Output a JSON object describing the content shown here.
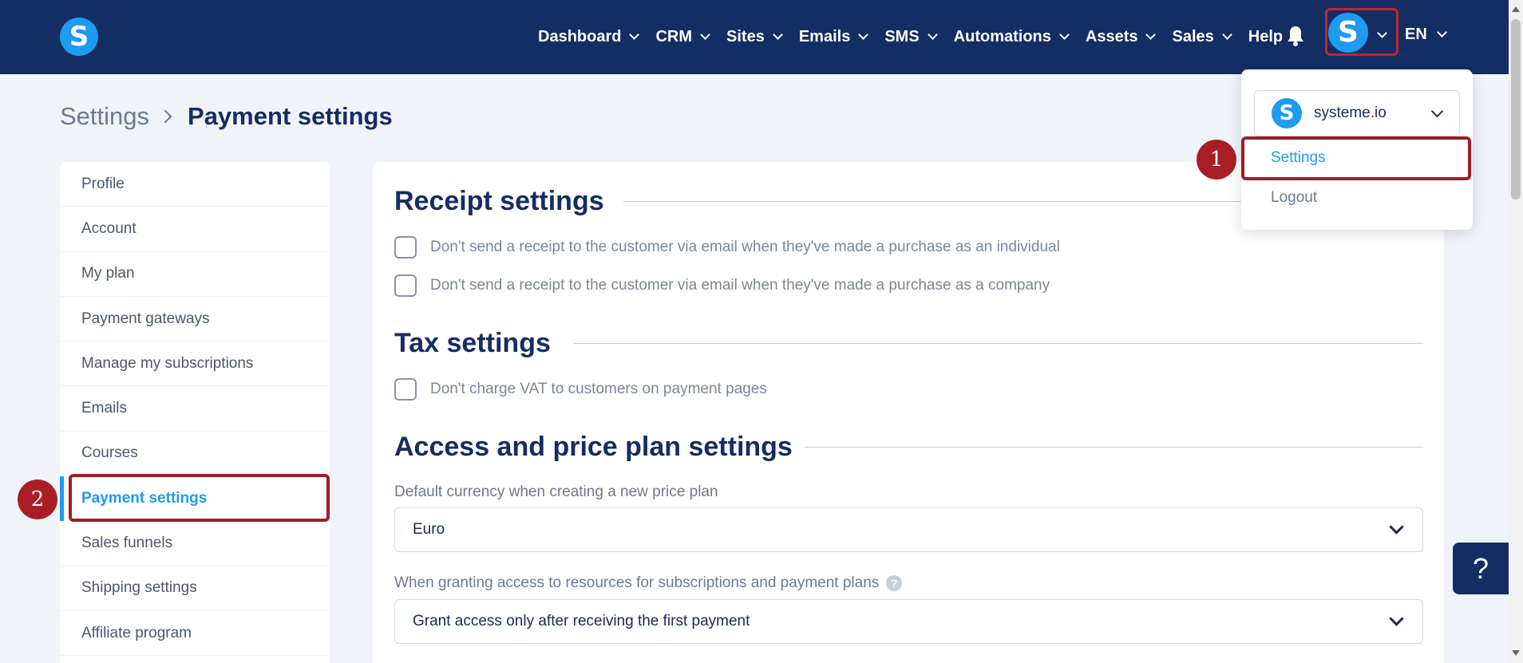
{
  "app": {
    "logo_letter": "S"
  },
  "nav": {
    "items": [
      {
        "label": "Dashboard",
        "has_dropdown": true
      },
      {
        "label": "CRM",
        "has_dropdown": true
      },
      {
        "label": "Sites",
        "has_dropdown": true
      },
      {
        "label": "Emails",
        "has_dropdown": true
      },
      {
        "label": "SMS",
        "has_dropdown": true
      },
      {
        "label": "Automations",
        "has_dropdown": true
      },
      {
        "label": "Assets",
        "has_dropdown": true
      },
      {
        "label": "Sales",
        "has_dropdown": true
      },
      {
        "label": "Help",
        "has_dropdown": false
      }
    ],
    "bell_icon": "bell-icon",
    "avatar_letter": "S",
    "language": "EN"
  },
  "breadcrumb": {
    "parent": "Settings",
    "current": "Payment settings"
  },
  "sidebar": {
    "items": [
      {
        "label": "Profile",
        "active": false
      },
      {
        "label": "Account",
        "active": false
      },
      {
        "label": "My plan",
        "active": false
      },
      {
        "label": "Payment gateways",
        "active": false
      },
      {
        "label": "Manage my subscriptions",
        "active": false
      },
      {
        "label": "Emails",
        "active": false
      },
      {
        "label": "Courses",
        "active": false
      },
      {
        "label": "Payment settings",
        "active": true
      },
      {
        "label": "Sales funnels",
        "active": false
      },
      {
        "label": "Shipping settings",
        "active": false
      },
      {
        "label": "Affiliate program",
        "active": false
      }
    ]
  },
  "main": {
    "receipt": {
      "title": "Receipt settings",
      "options": [
        {
          "label": "Don't send a receipt to the customer via email when they've made a purchase as an individual",
          "checked": false
        },
        {
          "label": "Don't send a receipt to the customer via email when they've made a purchase as a company",
          "checked": false
        }
      ]
    },
    "tax": {
      "title": "Tax settings",
      "options": [
        {
          "label": "Don't charge VAT to customers on payment pages",
          "checked": false
        }
      ]
    },
    "access": {
      "title": "Access and price plan settings",
      "currency_label": "Default currency when creating a new price plan",
      "currency_value": "Euro",
      "grant_label": "When granting access to resources for subscriptions and payment plans",
      "grant_help": "?",
      "grant_value": "Grant access only after receiving the first payment"
    }
  },
  "dropdown": {
    "account_name": "systeme.io",
    "account_logo_letter": "S",
    "settings_label": "Settings",
    "logout_label": "Logout"
  },
  "markers": {
    "first": "1",
    "second": "2"
  },
  "help_button": "?",
  "colors": {
    "nav_bg": "#142d63",
    "accent": "#1e9bf0",
    "highlight": "#a01c24",
    "page_bg": "#f0f4f9"
  }
}
